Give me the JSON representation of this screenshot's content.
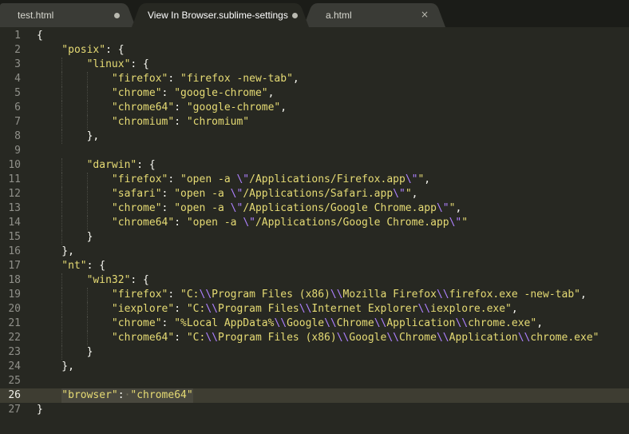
{
  "tabs": [
    {
      "label": "test.html",
      "state": "dirty"
    },
    {
      "label": "View In Browser.sublime-settings",
      "state": "dirty",
      "active": true
    },
    {
      "label": "a.html",
      "state": "close"
    }
  ],
  "icons": {
    "dirty": "dirty-dot-icon",
    "close": "close-icon"
  },
  "colors": {
    "background": "#272822",
    "string": "#e6db74",
    "escape": "#ae81ff",
    "punctuation": "#f8f8f2",
    "line_number": "#90908a",
    "current_line": "#3e3d32"
  },
  "editor": {
    "current_line": 26,
    "lines": [
      {
        "num": "1",
        "indent": 0,
        "tokens": [
          {
            "t": "{",
            "c": "p"
          }
        ]
      },
      {
        "num": "2",
        "indent": 1,
        "tokens": [
          {
            "t": "\"posix\"",
            "c": "s"
          },
          {
            "t": ": {",
            "c": "p"
          }
        ]
      },
      {
        "num": "3",
        "indent": 2,
        "tokens": [
          {
            "t": "\"linux\"",
            "c": "s"
          },
          {
            "t": ": {",
            "c": "p"
          }
        ]
      },
      {
        "num": "4",
        "indent": 3,
        "tokens": [
          {
            "t": "\"firefox\"",
            "c": "s"
          },
          {
            "t": ": ",
            "c": "p"
          },
          {
            "t": "\"firefox -new-tab\"",
            "c": "s"
          },
          {
            "t": ",",
            "c": "p"
          }
        ]
      },
      {
        "num": "5",
        "indent": 3,
        "tokens": [
          {
            "t": "\"chrome\"",
            "c": "s"
          },
          {
            "t": ": ",
            "c": "p"
          },
          {
            "t": "\"google-chrome\"",
            "c": "s"
          },
          {
            "t": ",",
            "c": "p"
          }
        ]
      },
      {
        "num": "6",
        "indent": 3,
        "tokens": [
          {
            "t": "\"chrome64\"",
            "c": "s"
          },
          {
            "t": ": ",
            "c": "p"
          },
          {
            "t": "\"google-chrome\"",
            "c": "s"
          },
          {
            "t": ",",
            "c": "p"
          }
        ]
      },
      {
        "num": "7",
        "indent": 3,
        "tokens": [
          {
            "t": "\"chromium\"",
            "c": "s"
          },
          {
            "t": ": ",
            "c": "p"
          },
          {
            "t": "\"chromium\"",
            "c": "s"
          }
        ]
      },
      {
        "num": "8",
        "indent": 2,
        "tokens": [
          {
            "t": "},",
            "c": "p"
          }
        ]
      },
      {
        "num": "9",
        "indent": 0,
        "tokens": []
      },
      {
        "num": "10",
        "indent": 2,
        "tokens": [
          {
            "t": "\"darwin\"",
            "c": "s"
          },
          {
            "t": ": {",
            "c": "p"
          }
        ]
      },
      {
        "num": "11",
        "indent": 3,
        "tokens": [
          {
            "t": "\"firefox\"",
            "c": "s"
          },
          {
            "t": ": ",
            "c": "p"
          },
          {
            "t": "\"open -a ",
            "c": "s"
          },
          {
            "t": "\\\"",
            "c": "e"
          },
          {
            "t": "/Applications/Firefox.app",
            "c": "s"
          },
          {
            "t": "\\\"",
            "c": "e"
          },
          {
            "t": "\"",
            "c": "s"
          },
          {
            "t": ",",
            "c": "p"
          }
        ]
      },
      {
        "num": "12",
        "indent": 3,
        "tokens": [
          {
            "t": "\"safari\"",
            "c": "s"
          },
          {
            "t": ": ",
            "c": "p"
          },
          {
            "t": "\"open -a ",
            "c": "s"
          },
          {
            "t": "\\\"",
            "c": "e"
          },
          {
            "t": "/Applications/Safari.app",
            "c": "s"
          },
          {
            "t": "\\\"",
            "c": "e"
          },
          {
            "t": "\"",
            "c": "s"
          },
          {
            "t": ",",
            "c": "p"
          }
        ]
      },
      {
        "num": "13",
        "indent": 3,
        "tokens": [
          {
            "t": "\"chrome\"",
            "c": "s"
          },
          {
            "t": ": ",
            "c": "p"
          },
          {
            "t": "\"open -a ",
            "c": "s"
          },
          {
            "t": "\\\"",
            "c": "e"
          },
          {
            "t": "/Applications/Google Chrome.app",
            "c": "s"
          },
          {
            "t": "\\\"",
            "c": "e"
          },
          {
            "t": "\"",
            "c": "s"
          },
          {
            "t": ",",
            "c": "p"
          }
        ]
      },
      {
        "num": "14",
        "indent": 3,
        "tokens": [
          {
            "t": "\"chrome64\"",
            "c": "s"
          },
          {
            "t": ": ",
            "c": "p"
          },
          {
            "t": "\"open -a ",
            "c": "s"
          },
          {
            "t": "\\\"",
            "c": "e"
          },
          {
            "t": "/Applications/Google Chrome.app",
            "c": "s"
          },
          {
            "t": "\\\"",
            "c": "e"
          },
          {
            "t": "\"",
            "c": "s"
          }
        ]
      },
      {
        "num": "15",
        "indent": 2,
        "tokens": [
          {
            "t": "}",
            "c": "p"
          }
        ]
      },
      {
        "num": "16",
        "indent": 1,
        "tokens": [
          {
            "t": "},",
            "c": "p"
          }
        ]
      },
      {
        "num": "17",
        "indent": 1,
        "tokens": [
          {
            "t": "\"nt\"",
            "c": "s"
          },
          {
            "t": ": {",
            "c": "p"
          }
        ]
      },
      {
        "num": "18",
        "indent": 2,
        "tokens": [
          {
            "t": "\"win32\"",
            "c": "s"
          },
          {
            "t": ": {",
            "c": "p"
          }
        ]
      },
      {
        "num": "19",
        "indent": 3,
        "tokens": [
          {
            "t": "\"firefox\"",
            "c": "s"
          },
          {
            "t": ": ",
            "c": "p"
          },
          {
            "t": "\"C:",
            "c": "s"
          },
          {
            "t": "\\\\",
            "c": "e"
          },
          {
            "t": "Program Files (x86)",
            "c": "s"
          },
          {
            "t": "\\\\",
            "c": "e"
          },
          {
            "t": "Mozilla Firefox",
            "c": "s"
          },
          {
            "t": "\\\\",
            "c": "e"
          },
          {
            "t": "firefox.exe -new-tab\"",
            "c": "s"
          },
          {
            "t": ",",
            "c": "p"
          }
        ]
      },
      {
        "num": "20",
        "indent": 3,
        "tokens": [
          {
            "t": "\"iexplore\"",
            "c": "s"
          },
          {
            "t": ": ",
            "c": "p"
          },
          {
            "t": "\"C:",
            "c": "s"
          },
          {
            "t": "\\\\",
            "c": "e"
          },
          {
            "t": "Program Files",
            "c": "s"
          },
          {
            "t": "\\\\",
            "c": "e"
          },
          {
            "t": "Internet Explorer",
            "c": "s"
          },
          {
            "t": "\\\\",
            "c": "e"
          },
          {
            "t": "iexplore.exe\"",
            "c": "s"
          },
          {
            "t": ",",
            "c": "p"
          }
        ]
      },
      {
        "num": "21",
        "indent": 3,
        "tokens": [
          {
            "t": "\"chrome\"",
            "c": "s"
          },
          {
            "t": ": ",
            "c": "p"
          },
          {
            "t": "\"%Local AppData%",
            "c": "s"
          },
          {
            "t": "\\\\",
            "c": "e"
          },
          {
            "t": "Google",
            "c": "s"
          },
          {
            "t": "\\\\",
            "c": "e"
          },
          {
            "t": "Chrome",
            "c": "s"
          },
          {
            "t": "\\\\",
            "c": "e"
          },
          {
            "t": "Application",
            "c": "s"
          },
          {
            "t": "\\\\",
            "c": "e"
          },
          {
            "t": "chrome.exe\"",
            "c": "s"
          },
          {
            "t": ",",
            "c": "p"
          }
        ]
      },
      {
        "num": "22",
        "indent": 3,
        "tokens": [
          {
            "t": "\"chrome64\"",
            "c": "s"
          },
          {
            "t": ": ",
            "c": "p"
          },
          {
            "t": "\"C:",
            "c": "s"
          },
          {
            "t": "\\\\",
            "c": "e"
          },
          {
            "t": "Program Files (x86)",
            "c": "s"
          },
          {
            "t": "\\\\",
            "c": "e"
          },
          {
            "t": "Google",
            "c": "s"
          },
          {
            "t": "\\\\",
            "c": "e"
          },
          {
            "t": "Chrome",
            "c": "s"
          },
          {
            "t": "\\\\",
            "c": "e"
          },
          {
            "t": "Application",
            "c": "s"
          },
          {
            "t": "\\\\",
            "c": "e"
          },
          {
            "t": "chrome.exe\"",
            "c": "s"
          }
        ]
      },
      {
        "num": "23",
        "indent": 2,
        "tokens": [
          {
            "t": "}",
            "c": "p"
          }
        ]
      },
      {
        "num": "24",
        "indent": 1,
        "tokens": [
          {
            "t": "},",
            "c": "p"
          }
        ]
      },
      {
        "num": "25",
        "indent": 0,
        "tokens": []
      },
      {
        "num": "26",
        "indent": 1,
        "tokens": [
          {
            "t": "\"browser\"",
            "c": "s"
          },
          {
            "t": ":",
            "c": "p"
          },
          {
            "t": "·",
            "c": "ws"
          },
          {
            "t": "\"chrome64\"",
            "c": "s"
          }
        ]
      },
      {
        "num": "27",
        "indent": 0,
        "tokens": [
          {
            "t": "}",
            "c": "p"
          }
        ]
      }
    ]
  }
}
